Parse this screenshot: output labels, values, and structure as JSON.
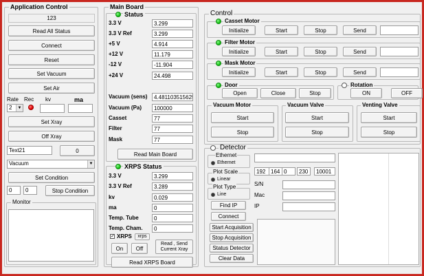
{
  "app": {
    "title": "Application Control",
    "counter": "123",
    "buttons": {
      "read_all_status": "Read All Status",
      "connect": "Connect",
      "reset": "Reset",
      "set_vacuum": "Set Vacuum",
      "set_air": "Set Air",
      "set_xray": "Set Xray",
      "off_xray": "Off Xray",
      "zero": "0",
      "set_condition": "Set Condition",
      "stop_condition": "Stop Condition"
    },
    "rate_label": "Rate",
    "rec_label": "Rec",
    "kv_label": "kv",
    "ma_label": "ma",
    "rate_value": "2",
    "text21": "Text21",
    "combo_value": "Vacuum",
    "cond_a": "0",
    "cond_b": "0",
    "monitor_label": "Monitor"
  },
  "main": {
    "title": "Main Board",
    "status_title": "Status",
    "status_rows": [
      {
        "label": "3.3 V",
        "value": "3.299"
      },
      {
        "label": "3.3 V Ref",
        "value": "3.299"
      },
      {
        "label": "+5  V",
        "value": "4.914"
      },
      {
        "label": "+12 V",
        "value": "11.179"
      },
      {
        "label": "-12 V",
        "value": "-11.904"
      },
      {
        "label": "+24 V",
        "value": "24.498"
      }
    ],
    "vac_rows": [
      {
        "label": "Vacuum (sens)",
        "value": "4.481103515625"
      },
      {
        "label": "Vacuum (Pa)",
        "value": "100000"
      },
      {
        "label": "Casset",
        "value": "77"
      },
      {
        "label": "Filter",
        "value": "77"
      },
      {
        "label": "Mask",
        "value": "77"
      }
    ],
    "read_main_board": "Read Main Board",
    "xrps_title": "XRPS Status",
    "xrps_rows": [
      {
        "label": "3.3 V",
        "value": "3.299"
      },
      {
        "label": "3.3 V Ref",
        "value": "3.289"
      },
      {
        "label": "kv",
        "value": "0.029"
      },
      {
        "label": "ma",
        "value": "0"
      },
      {
        "label": "Temp. Tube",
        "value": "0"
      },
      {
        "label": "Temp. Cham.",
        "value": "0"
      }
    ],
    "xrps_check": "XRPS",
    "xrps_small": "xrps",
    "on": "On",
    "off": "Off",
    "read_send": "Read , Send Current Xray",
    "read_xrps_board": "Read XRPS Board"
  },
  "control": {
    "title": "Control",
    "motors": [
      {
        "name": "Casset Motor",
        "buttons": [
          "Initialize",
          "Start",
          "Stop",
          "Send"
        ]
      },
      {
        "name": "Filter Motor",
        "buttons": [
          "Initialize",
          "Start",
          "Stop",
          "Send"
        ]
      },
      {
        "name": "Mask Motor",
        "buttons": [
          "Initialize",
          "Start",
          "Stop",
          "Send"
        ]
      }
    ],
    "door": {
      "title": "Door",
      "buttons": [
        "Open",
        "Close",
        "Stop"
      ]
    },
    "rotation": {
      "title": "Rotation",
      "buttons": [
        "ON",
        "OFF"
      ]
    },
    "vacuum_motor": {
      "title": "Vacuum Motor",
      "buttons": [
        "Start",
        "Stop"
      ]
    },
    "vacuum_valve": {
      "title": "Vacuum Valve",
      "buttons": [
        "Start",
        "Stop"
      ]
    },
    "venting_valve": {
      "title": "Venting Valve",
      "buttons": [
        "Start",
        "Stop"
      ]
    }
  },
  "detector": {
    "title": "Detector",
    "ethernet_label": "Ethernet",
    "ethernet_opt": "Ethernet",
    "plot_scale_label": "Plot Scale",
    "plot_scale_opt": "Linear",
    "plot_type_label": "Plot Type",
    "plot_type_opt": "Line",
    "ip_fields": [
      "192",
      "164",
      "0",
      "230",
      "10001"
    ],
    "sn_label": "S/N",
    "mac_label": "Mac",
    "ip_label": "IP",
    "find_ip": "Find IP",
    "connect": "Connect",
    "start_acq": "Start Acquisition",
    "stop_acq": "Stop Acquisition",
    "status_det": "Status Detector",
    "clear_data": "Clear Data"
  }
}
